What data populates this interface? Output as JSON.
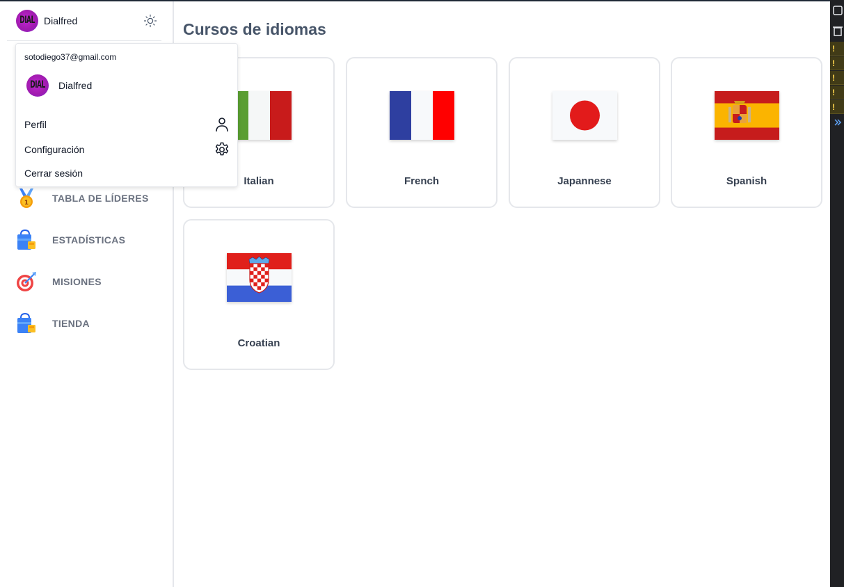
{
  "user": {
    "name": "Dialfred",
    "email": "sotodiego37@gmail.com",
    "avatar_text": "DIAL"
  },
  "nav": {
    "items": [
      {
        "label": "TABLA DE LÍDERES",
        "icon": "medal-icon"
      },
      {
        "label": "ESTADÍSTICAS",
        "icon": "shopping-bag-icon"
      },
      {
        "label": "MISIONES",
        "icon": "target-icon"
      },
      {
        "label": "TIENDA",
        "icon": "shopping-bag-icon"
      }
    ]
  },
  "dropdown": {
    "profile_label": "Perfil",
    "settings_label": "Configuración",
    "logout_label": "Cerrar sesión"
  },
  "main": {
    "title": "Cursos de idiomas",
    "courses": [
      {
        "label": "Italian",
        "flag": "italy-flag"
      },
      {
        "label": "French",
        "flag": "france-flag"
      },
      {
        "label": "Japannese",
        "flag": "japan-flag"
      },
      {
        "label": "Spanish",
        "flag": "spain-flag"
      },
      {
        "label": "Croatian",
        "flag": "croatia-flag"
      }
    ]
  },
  "colors": {
    "accent_purple": "#a21caf",
    "nav_text": "#6b7280",
    "title": "#475569",
    "card_border": "#e5e7eb"
  },
  "devtools": {
    "warning_glyph": "!"
  }
}
